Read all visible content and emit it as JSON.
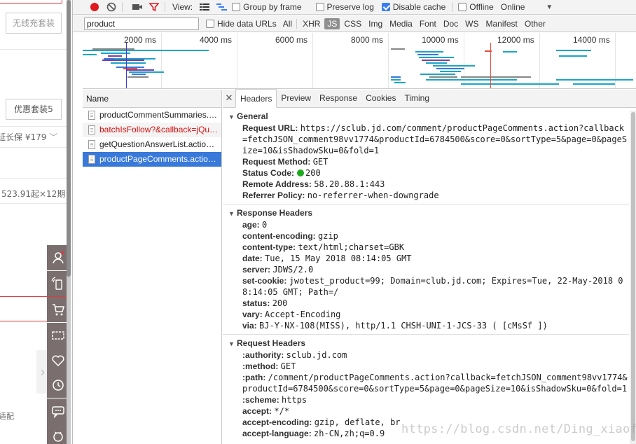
{
  "left_page": {
    "package_button_1": "无线充套装",
    "package_button_2": "优惠套装5",
    "warranty_text": "延长保 ¥179",
    "installment_text": "523.91起×12期",
    "adapter_text": "适配"
  },
  "toolbar": {
    "view_label": "View:",
    "group_by_frame": "Group by frame",
    "preserve_log": "Preserve log",
    "disable_cache": "Disable cache",
    "offline": "Offline",
    "throttle": "Online",
    "preserve_log_checked": false,
    "disable_cache_checked": true,
    "offline_checked": false,
    "group_by_frame_checked": false
  },
  "filter": {
    "value": "product",
    "hide_data_urls": "Hide data URLs",
    "types": [
      "All",
      "XHR",
      "JS",
      "CSS",
      "Img",
      "Media",
      "Font",
      "Doc",
      "WS",
      "Manifest",
      "Other"
    ],
    "active_type": "JS"
  },
  "timeline": {
    "labels": [
      "2000 ms",
      "4000 ms",
      "6000 ms",
      "8000 ms",
      "10000 ms",
      "12000 ms",
      "14000 ms"
    ]
  },
  "request_list": {
    "header": "Name",
    "rows": [
      {
        "name": "productCommentSummaries.…",
        "state": "normal"
      },
      {
        "name": "batchIsFollow?&callback=jQu…",
        "state": "error"
      },
      {
        "name": "getQuestionAnswerList.actio…",
        "state": "normal"
      },
      {
        "name": "productPageComments.actio…",
        "state": "selected"
      }
    ]
  },
  "detail_tabs": [
    "Headers",
    "Preview",
    "Response",
    "Cookies",
    "Timing"
  ],
  "general": {
    "title": "General",
    "request_url_key": "Request URL:",
    "request_url": "https://sclub.jd.com/comment/productPageComments.action?callback=fetchJSON_comment98vv1774&productId=6784500&score=0&sortType=5&page=0&pageSize=10&isShadowSku=0&fold=1",
    "request_method_key": "Request Method:",
    "request_method": "GET",
    "status_code_key": "Status Code:",
    "status_code": "200",
    "remote_address_key": "Remote Address:",
    "remote_address": "58.20.88.1:443",
    "referrer_policy_key": "Referrer Policy:",
    "referrer_policy": "no-referrer-when-downgrade"
  },
  "response_headers": {
    "title": "Response Headers",
    "items": [
      {
        "k": "age:",
        "v": "0"
      },
      {
        "k": "content-encoding:",
        "v": "gzip"
      },
      {
        "k": "content-type:",
        "v": "text/html;charset=GBK"
      },
      {
        "k": "date:",
        "v": "Tue, 15 May 2018 08:14:05 GMT"
      },
      {
        "k": "server:",
        "v": "JDWS/2.0"
      },
      {
        "k": "set-cookie:",
        "v": "jwotest_product=99; Domain=club.jd.com; Expires=Tue, 22-May-2018 08:14:05 GMT; Path=/"
      },
      {
        "k": "status:",
        "v": "200"
      },
      {
        "k": "vary:",
        "v": "Accept-Encoding"
      },
      {
        "k": "via:",
        "v": "BJ-Y-NX-108(MISS), http/1.1 CHSH-UNI-1-JCS-33 ( [cMsSf ])"
      }
    ]
  },
  "request_headers": {
    "title": "Request Headers",
    "items": [
      {
        "k": ":authority:",
        "v": "sclub.jd.com"
      },
      {
        "k": ":method:",
        "v": "GET"
      },
      {
        "k": ":path:",
        "v": "/comment/productPageComments.action?callback=fetchJSON_comment98vv1774&productId=6784500&score=0&sortType=5&page=0&pageSize=10&isShadowSku=0&fold=1"
      },
      {
        "k": ":scheme:",
        "v": "https"
      },
      {
        "k": "accept:",
        "v": "*/*"
      },
      {
        "k": "accept-encoding:",
        "v": "gzip, deflate, br"
      },
      {
        "k": "accept-language:",
        "v": "zh-CN,zh;q=0.9"
      }
    ]
  },
  "watermark": "https://blog.csdn.net/Ding_xiaofei",
  "colors": {
    "selected_row": "#3879d9",
    "error_text": "#d80d0d",
    "record_red": "#e0191f",
    "status_green": "#1daa1d"
  }
}
